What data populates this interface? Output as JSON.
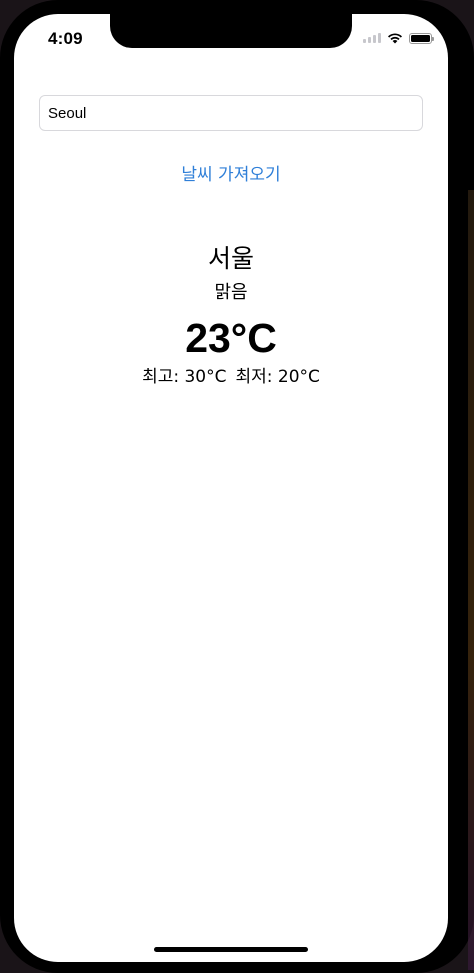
{
  "status_bar": {
    "time": "4:09",
    "signal_icon": "cellular-signal-icon",
    "wifi_icon": "wifi-icon",
    "battery_icon": "battery-icon"
  },
  "search": {
    "value": "Seoul",
    "placeholder": ""
  },
  "fetch_button": {
    "label": "날씨 가져오기"
  },
  "weather": {
    "city": "서울",
    "condition": "맑음",
    "temperature": "23°C",
    "max_label": "최고: 30°C",
    "min_label": "최저: 20°C"
  },
  "colors": {
    "accent": "#2f7fd8",
    "background": "#ffffff",
    "device_frame": "#000000"
  }
}
